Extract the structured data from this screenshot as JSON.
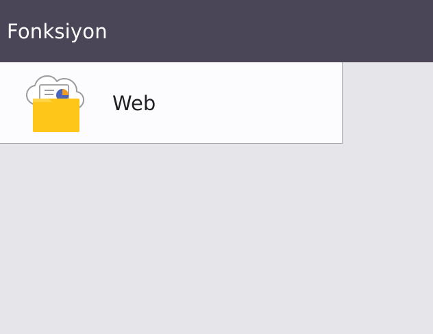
{
  "header": {
    "title": "Fonksiyon"
  },
  "menu": {
    "items": [
      {
        "label": "Web",
        "icon": "web-cloud-folder-icon"
      }
    ]
  },
  "colors": {
    "header_background": "#4a4658",
    "page_background": "#e6e5ea",
    "item_background": "#fcfbfd",
    "folder": "#ffc61a",
    "chart_blue": "#4a64b7",
    "chart_orange": "#f29b1f"
  }
}
